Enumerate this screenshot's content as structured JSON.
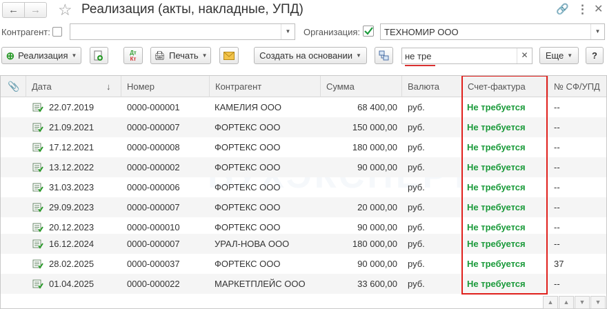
{
  "window": {
    "title": "Реализация (акты, накладные, УПД)"
  },
  "filters": {
    "counterparty_label": "Контрагент:",
    "counterparty_value": "",
    "organization_label": "Организация:",
    "organization_value": "ТЕХНОМИР ООО"
  },
  "toolbar": {
    "realization_label": "Реализация",
    "print_label": "Печать",
    "create_based_label": "Создать на основании",
    "search_value": "не тре",
    "more_label": "Еще",
    "help_label": "?"
  },
  "table": {
    "columns": [
      "Дата",
      "Номер",
      "Контрагент",
      "Сумма",
      "Валюта",
      "Счет-фактура",
      "№ СФ/УПД"
    ],
    "rows": [
      {
        "date": "22.07.2019",
        "number": "0000-000001",
        "counterparty": "КАМЕЛИЯ ООО",
        "sum": "68 400,00",
        "currency": "руб.",
        "invoice": "Не требуется",
        "invoice_no": "--"
      },
      {
        "date": "21.09.2021",
        "number": "0000-000007",
        "counterparty": "ФОРТЕКС ООО",
        "sum": "150 000,00",
        "currency": "руб.",
        "invoice": "Не требуется",
        "invoice_no": "--"
      },
      {
        "date": "17.12.2021",
        "number": "0000-000008",
        "counterparty": "ФОРТЕКС ООО",
        "sum": "180 000,00",
        "currency": "руб.",
        "invoice": "Не требуется",
        "invoice_no": "--"
      },
      {
        "date": "13.12.2022",
        "number": "0000-000002",
        "counterparty": "ФОРТЕКС ООО",
        "sum": "90 000,00",
        "currency": "руб.",
        "invoice": "Не требуется",
        "invoice_no": "--"
      },
      {
        "date": "31.03.2023",
        "number": "0000-000006",
        "counterparty": "ФОРТЕКС ООО",
        "sum": "",
        "currency": "руб.",
        "invoice": "Не требуется",
        "invoice_no": "--"
      },
      {
        "date": "29.09.2023",
        "number": "0000-000007",
        "counterparty": "ФОРТЕКС ООО",
        "sum": "20 000,00",
        "currency": "руб.",
        "invoice": "Не требуется",
        "invoice_no": "--"
      },
      {
        "date": "20.12.2023",
        "number": "0000-000010",
        "counterparty": "ФОРТЕКС ООО",
        "sum": "90 000,00",
        "currency": "руб.",
        "invoice": "Не требуется",
        "invoice_no": "--"
      },
      {
        "date": "16.12.2024",
        "number": "0000-000007",
        "counterparty": "УРАЛ-НОВА ООО",
        "sum": "180 000,00",
        "currency": "руб.",
        "invoice": "Не требуется",
        "invoice_no": "--"
      },
      {
        "date": "28.02.2025",
        "number": "0000-000037",
        "counterparty": "ФОРТЕКС ООО",
        "sum": "90 000,00",
        "currency": "руб.",
        "invoice": "Не требуется",
        "invoice_no": "37"
      },
      {
        "date": "01.04.2025",
        "number": "0000-000022",
        "counterparty": "МАРКЕТПЛЕЙС ООО",
        "sum": "33 600,00",
        "currency": "руб.",
        "invoice": "Не требуется",
        "invoice_no": "--"
      }
    ]
  },
  "colors": {
    "accent_green": "#1a9a3a",
    "highlight_red": "#e0201c"
  }
}
